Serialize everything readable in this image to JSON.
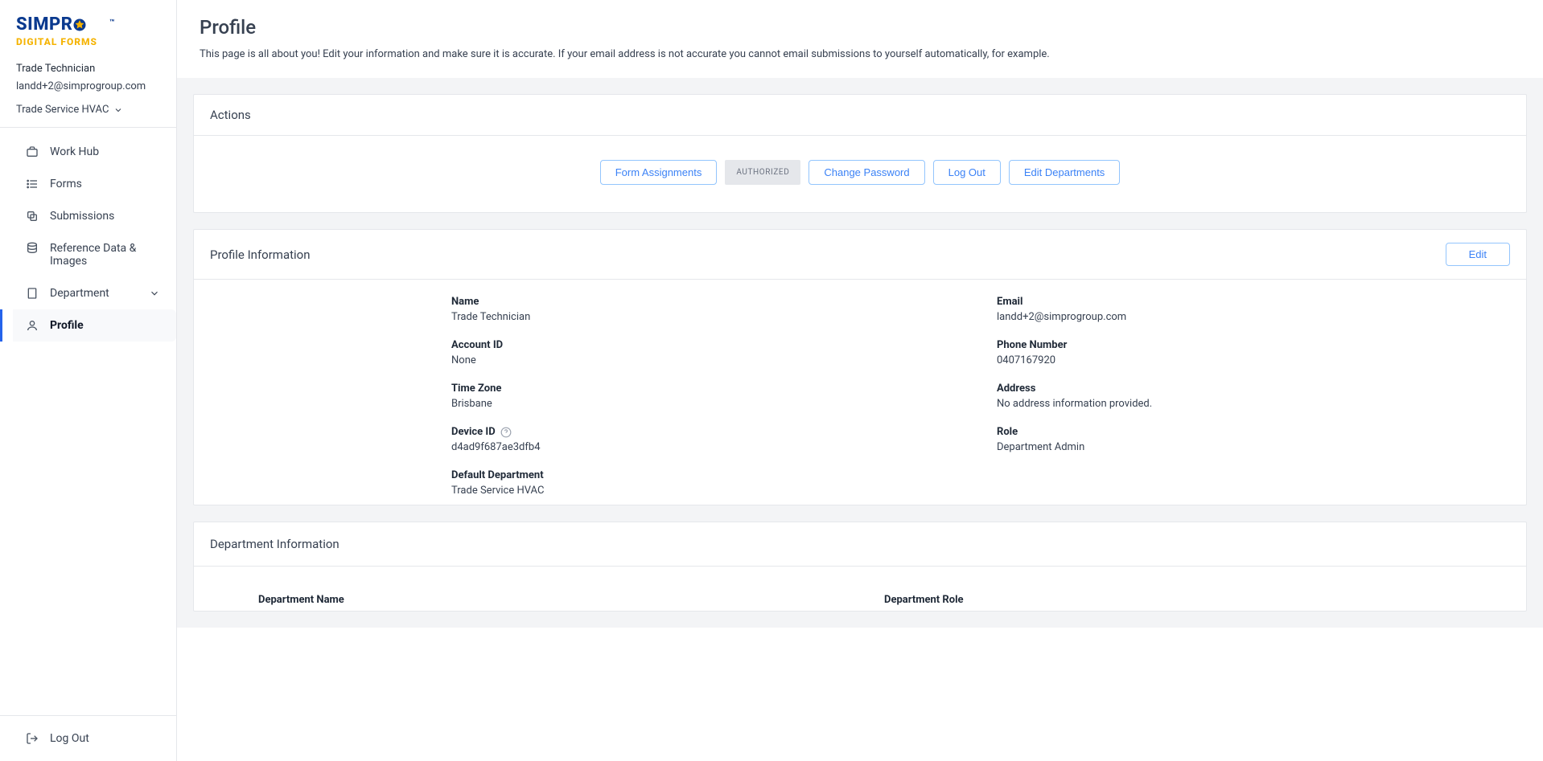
{
  "logo": {
    "main": "SIMPR",
    "trademark": "™",
    "sub": "DIGITAL FORMS"
  },
  "user": {
    "name": "Trade Technician",
    "email": "landd+2@simprogroup.com"
  },
  "company": {
    "selected": "Trade Service HVAC"
  },
  "nav": {
    "workhub": "Work Hub",
    "forms": "Forms",
    "submissions": "Submissions",
    "refdata": "Reference Data & Images",
    "department": "Department",
    "profile": "Profile"
  },
  "logout": "Log Out",
  "page": {
    "title": "Profile",
    "description": "This page is all about you! Edit your information and make sure it is accurate. If your email address is not accurate you cannot email submissions to yourself automatically, for example."
  },
  "actions": {
    "heading": "Actions",
    "form_assignments": "Form Assignments",
    "authorized": "AUTHORIZED",
    "change_password": "Change Password",
    "log_out": "Log Out",
    "edit_departments": "Edit Departments"
  },
  "profile_info": {
    "heading": "Profile Information",
    "edit": "Edit",
    "labels": {
      "name": "Name",
      "account_id": "Account ID",
      "time_zone": "Time Zone",
      "device_id": "Device ID",
      "default_department": "Default Department",
      "email": "Email",
      "phone": "Phone Number",
      "address": "Address",
      "role": "Role"
    },
    "values": {
      "name": "Trade Technician",
      "account_id": "None",
      "time_zone": "Brisbane",
      "device_id": "d4ad9f687ae3dfb4",
      "default_department": "Trade Service HVAC",
      "email": "landd+2@simprogroup.com",
      "phone": "0407167920",
      "address": "No address information provided.",
      "role": "Department Admin"
    }
  },
  "department_info": {
    "heading": "Department Information",
    "cols": {
      "name": "Department Name",
      "role": "Department Role"
    }
  }
}
